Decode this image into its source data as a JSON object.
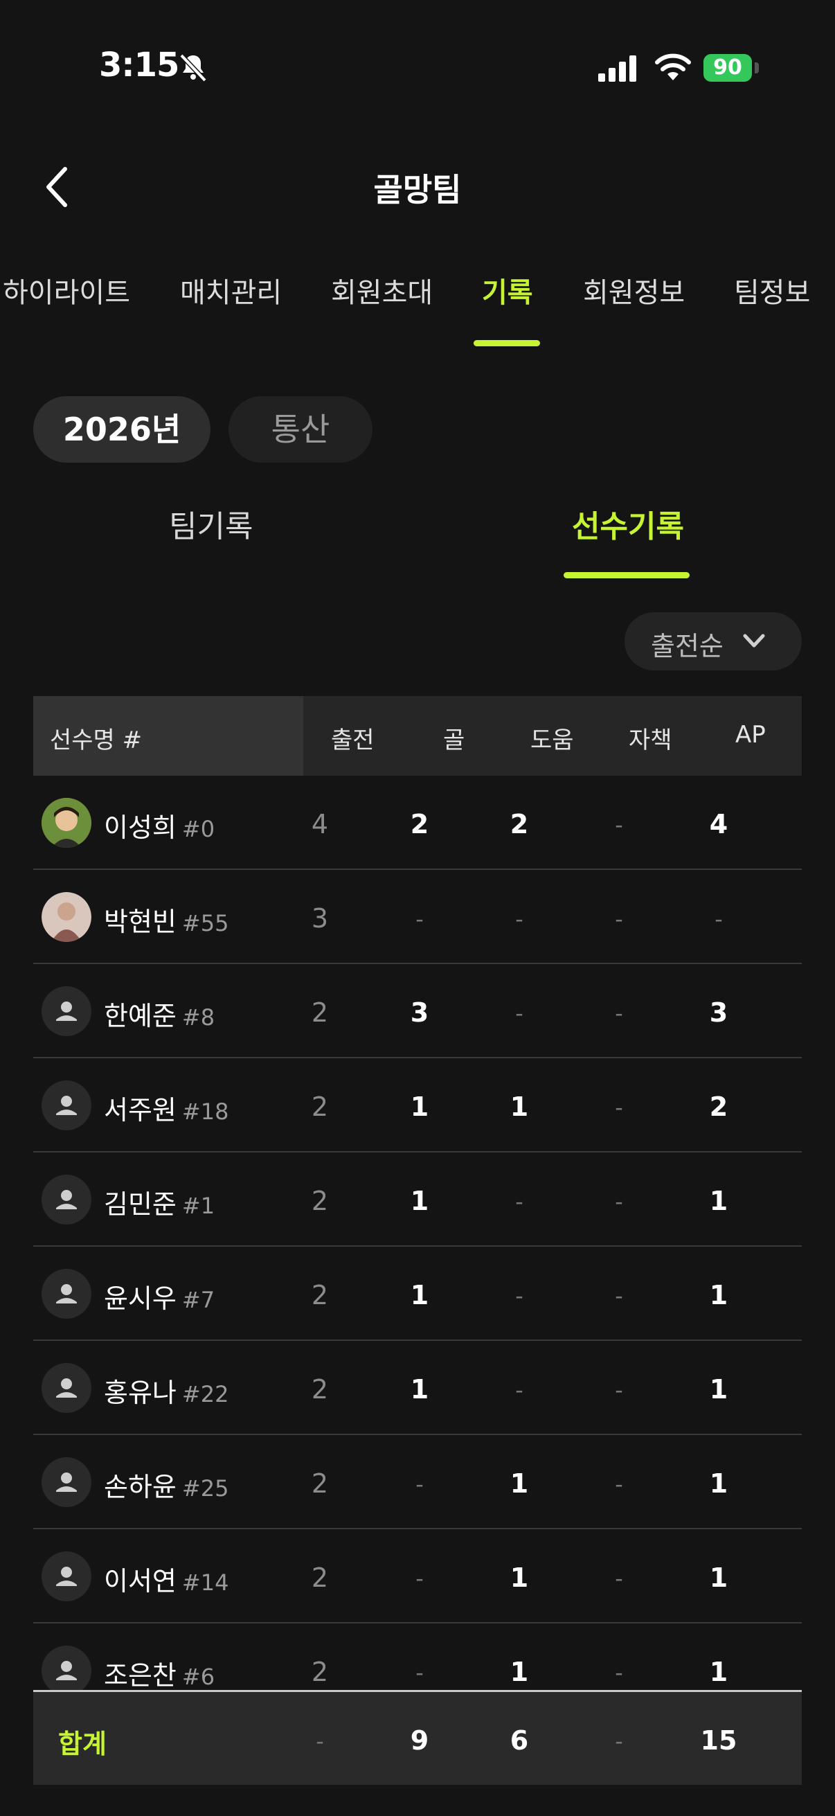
{
  "status": {
    "time": "3:15",
    "battery": "90"
  },
  "header": {
    "title": "골망팀"
  },
  "nav": {
    "tabs": [
      "하이라이트",
      "매치관리",
      "회원초대",
      "기록",
      "회원정보",
      "팀정보"
    ],
    "active": "기록"
  },
  "period": {
    "year": "2026년",
    "total": "통산"
  },
  "subtabs": {
    "team": "팀기록",
    "player": "선수기록"
  },
  "sort": {
    "label": "출전순"
  },
  "table": {
    "headers": {
      "name": "선수명 #",
      "apps": "출전",
      "goals": "골",
      "assists": "도움",
      "own_goals": "자책",
      "ap": "AP"
    },
    "rows": [
      {
        "name": "이성희",
        "number": "#0",
        "apps": "4",
        "goals": "2",
        "assists": "2",
        "own_goals": "-",
        "ap": "4"
      },
      {
        "name": "박현빈",
        "number": "#55",
        "apps": "3",
        "goals": "-",
        "assists": "-",
        "own_goals": "-",
        "ap": "-"
      },
      {
        "name": "한예준",
        "number": "#8",
        "apps": "2",
        "goals": "3",
        "assists": "-",
        "own_goals": "-",
        "ap": "3"
      },
      {
        "name": "서주원",
        "number": "#18",
        "apps": "2",
        "goals": "1",
        "assists": "1",
        "own_goals": "-",
        "ap": "2"
      },
      {
        "name": "김민준",
        "number": "#1",
        "apps": "2",
        "goals": "1",
        "assists": "-",
        "own_goals": "-",
        "ap": "1"
      },
      {
        "name": "윤시우",
        "number": "#7",
        "apps": "2",
        "goals": "1",
        "assists": "-",
        "own_goals": "-",
        "ap": "1"
      },
      {
        "name": "홍유나",
        "number": "#22",
        "apps": "2",
        "goals": "1",
        "assists": "-",
        "own_goals": "-",
        "ap": "1"
      },
      {
        "name": "손하윤",
        "number": "#25",
        "apps": "2",
        "goals": "-",
        "assists": "1",
        "own_goals": "-",
        "ap": "1"
      },
      {
        "name": "이서연",
        "number": "#14",
        "apps": "2",
        "goals": "-",
        "assists": "1",
        "own_goals": "-",
        "ap": "1"
      },
      {
        "name": "조은찬",
        "number": "#6",
        "apps": "2",
        "goals": "-",
        "assists": "1",
        "own_goals": "-",
        "ap": "1"
      }
    ],
    "total": {
      "label": "합계",
      "apps": "-",
      "goals": "9",
      "assists": "6",
      "own_goals": "-",
      "ap": "15"
    }
  },
  "colors": {
    "accent": "#c6f432",
    "background": "#141414"
  }
}
